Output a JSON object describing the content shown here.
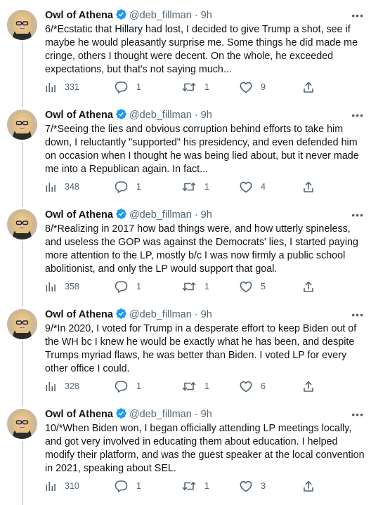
{
  "tweets": [
    {
      "name": "Owl of Athena",
      "handle": "@deb_fillman",
      "separator": "·",
      "time": "9h",
      "text": "6/*Ecstatic that Hillary had lost, I decided to give Trump a shot, see if maybe he would pleasantly surprise me. Some things he did made me cringe, others I thought were decent. On the whole, he exceeded expectations, but that's not saying much...",
      "views": "331",
      "replies": "1",
      "retweets": "1",
      "likes": "9"
    },
    {
      "name": "Owl of Athena",
      "handle": "@deb_fillman",
      "separator": "·",
      "time": "9h",
      "text": "7/*Seeing the lies and obvious corruption behind efforts to take him down, I reluctantly \"supported\" his presidency, and even defended him on occasion when I thought he was being lied about, but it never made me into a Republican again. In fact...",
      "views": "348",
      "replies": "1",
      "retweets": "1",
      "likes": "4"
    },
    {
      "name": "Owl of Athena",
      "handle": "@deb_fillman",
      "separator": "·",
      "time": "9h",
      "text": "8/*Realizing in 2017 how bad things were, and how utterly spineless, and useless the GOP was against the Democrats' lies, I started paying more attention to the LP, mostly b/c I was now firmly a public school abolitionist, and only the LP would support that goal.",
      "views": "358",
      "replies": "1",
      "retweets": "1",
      "likes": "5"
    },
    {
      "name": "Owl of Athena",
      "handle": "@deb_fillman",
      "separator": "·",
      "time": "9h",
      "text": "9/*In 2020, I voted for Trump in a desperate effort to keep Biden out of the WH bc I knew he would be exactly what he has been, and despite Trumps myriad flaws, he was better than Biden. I voted LP for every other office I could.",
      "views": "328",
      "replies": "1",
      "retweets": "1",
      "likes": "6"
    },
    {
      "name": "Owl of Athena",
      "handle": "@deb_fillman",
      "separator": "·",
      "time": "9h",
      "text": "10/*When Biden won, I began officially attending LP meetings locally, and got very involved in educating them about education. I helped modify their platform, and was the guest speaker at the local convention in 2021, speaking about SEL.",
      "views": "310",
      "replies": "1",
      "retweets": "1",
      "likes": "3"
    }
  ],
  "icons": {
    "verified": "verified-badge-icon",
    "more": "more-icon",
    "views": "analytics-icon",
    "reply": "reply-icon",
    "retweet": "retweet-icon",
    "like": "heart-icon",
    "share": "share-icon"
  },
  "colors": {
    "verified": "#1d9bf0",
    "secondary_text": "#536471",
    "thread_line": "#cfd9de"
  }
}
